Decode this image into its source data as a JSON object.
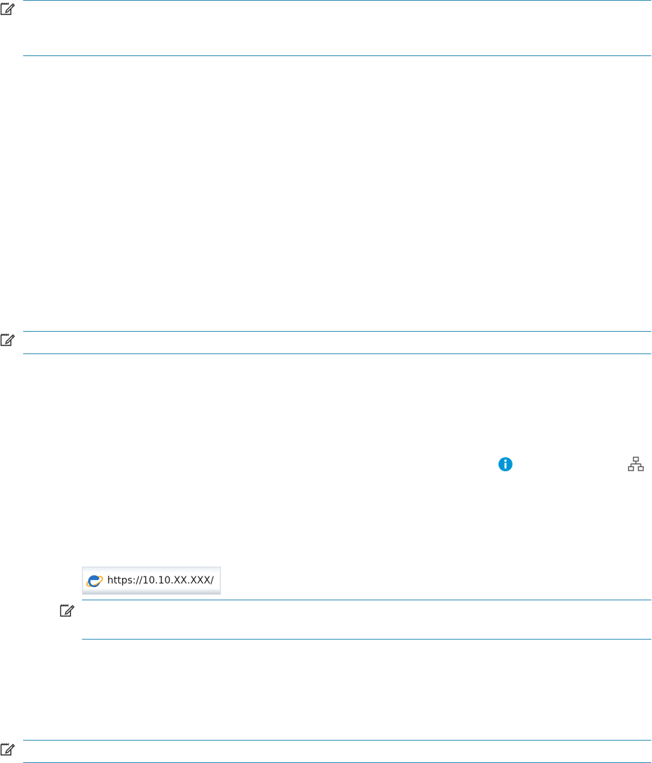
{
  "notes": [
    {
      "id": "note-1",
      "icon": "note-pencil-icon"
    },
    {
      "id": "note-2",
      "icon": "note-pencil-icon"
    },
    {
      "id": "note-3",
      "icon": "note-pencil-icon"
    },
    {
      "id": "note-4",
      "icon": "note-pencil-icon"
    }
  ],
  "inline_icons": {
    "info": {
      "icon": "info-icon",
      "color": "#0096d6"
    },
    "network": {
      "icon": "network-icon",
      "color": "#555555"
    }
  },
  "address_bar": {
    "browser_icon": "internet-explorer-icon",
    "url": "https://10.10.XX.XXX/"
  },
  "colors": {
    "rule": "#2a8ab4",
    "info_accent": "#0096d6"
  }
}
